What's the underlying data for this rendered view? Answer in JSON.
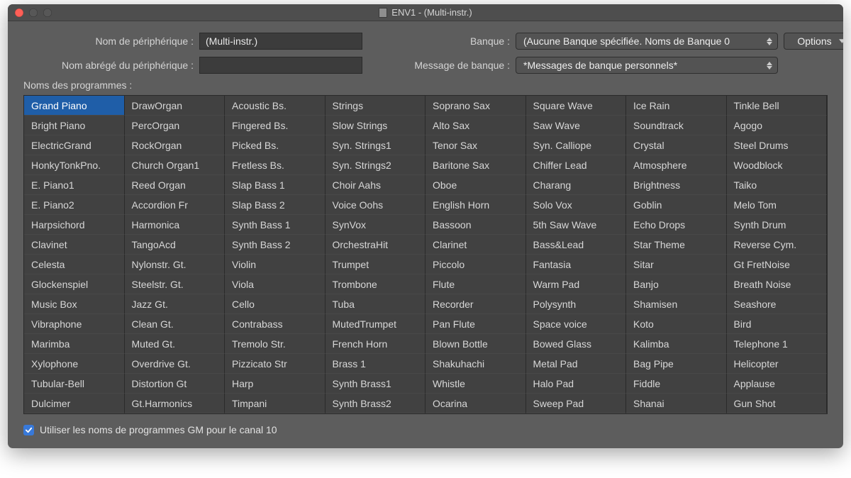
{
  "window": {
    "title": "ENV1 - (Multi-instr.)"
  },
  "form": {
    "device_name_label": "Nom de périphérique :",
    "device_name_value": "(Multi-instr.)",
    "short_name_label": "Nom abrégé du périphérique :",
    "short_name_value": "",
    "bank_label": "Banque :",
    "bank_value": "(Aucune Banque spécifiée. Noms de Banque 0",
    "bank_msg_label": "Message de banque :",
    "bank_msg_value": "*Messages de banque personnels*",
    "options_label": "Options"
  },
  "section": {
    "programs_label": "Noms des programmes :"
  },
  "programs": [
    "Grand Piano",
    "Bright Piano",
    "ElectricGrand",
    "HonkyTonkPno.",
    "E. Piano1",
    "E. Piano2",
    "Harpsichord",
    "Clavinet",
    "Celesta",
    "Glockenspiel",
    "Music Box",
    "Vibraphone",
    "Marimba",
    "Xylophone",
    "Tubular-Bell",
    "Dulcimer",
    "DrawOrgan",
    "PercOrgan",
    "RockOrgan",
    "Church Organ1",
    "Reed Organ",
    "Accordion Fr",
    "Harmonica",
    "TangoAcd",
    "Nylonstr. Gt.",
    "Steelstr. Gt.",
    "Jazz Gt.",
    "Clean Gt.",
    "Muted Gt.",
    "Overdrive Gt.",
    "Distortion Gt",
    "Gt.Harmonics",
    "Acoustic Bs.",
    "Fingered Bs.",
    "Picked Bs.",
    "Fretless Bs.",
    "Slap Bass 1",
    "Slap Bass 2",
    "Synth Bass 1",
    "Synth Bass 2",
    "Violin",
    "Viola",
    "Cello",
    "Contrabass",
    "Tremolo Str.",
    "Pizzicato Str",
    "Harp",
    "Timpani",
    "Strings",
    "Slow Strings",
    "Syn. Strings1",
    "Syn. Strings2",
    "Choir Aahs",
    "Voice Oohs",
    "SynVox",
    "OrchestraHit",
    "Trumpet",
    "Trombone",
    "Tuba",
    "MutedTrumpet",
    "French Horn",
    "Brass 1",
    "Synth Brass1",
    "Synth Brass2",
    "Soprano Sax",
    "Alto Sax",
    "Tenor Sax",
    "Baritone Sax",
    "Oboe",
    "English Horn",
    "Bassoon",
    "Clarinet",
    "Piccolo",
    "Flute",
    "Recorder",
    "Pan Flute",
    "Blown Bottle",
    "Shakuhachi",
    "Whistle",
    "Ocarina",
    "Square Wave",
    "Saw Wave",
    "Syn. Calliope",
    "Chiffer Lead",
    "Charang",
    "Solo Vox",
    "5th Saw Wave",
    "Bass&Lead",
    "Fantasia",
    "Warm Pad",
    "Polysynth",
    "Space voice",
    "Bowed Glass",
    "Metal Pad",
    "Halo Pad",
    "Sweep Pad",
    "Ice Rain",
    "Soundtrack",
    "Crystal",
    "Atmosphere",
    "Brightness",
    "Goblin",
    "Echo Drops",
    "Star Theme",
    "Sitar",
    "Banjo",
    "Shamisen",
    "Koto",
    "Kalimba",
    "Bag Pipe",
    "Fiddle",
    "Shanai",
    "Tinkle Bell",
    "Agogo",
    "Steel Drums",
    "Woodblock",
    "Taiko",
    "Melo Tom",
    "Synth Drum",
    "Reverse Cym.",
    "Gt FretNoise",
    "Breath Noise",
    "Seashore",
    "Bird",
    "Telephone 1",
    "Helicopter",
    "Applause",
    "Gun Shot"
  ],
  "selected_index": 0,
  "footer": {
    "gm_checkbox_label": "Utiliser les noms de programmes GM pour le canal 10",
    "gm_checked": true
  }
}
